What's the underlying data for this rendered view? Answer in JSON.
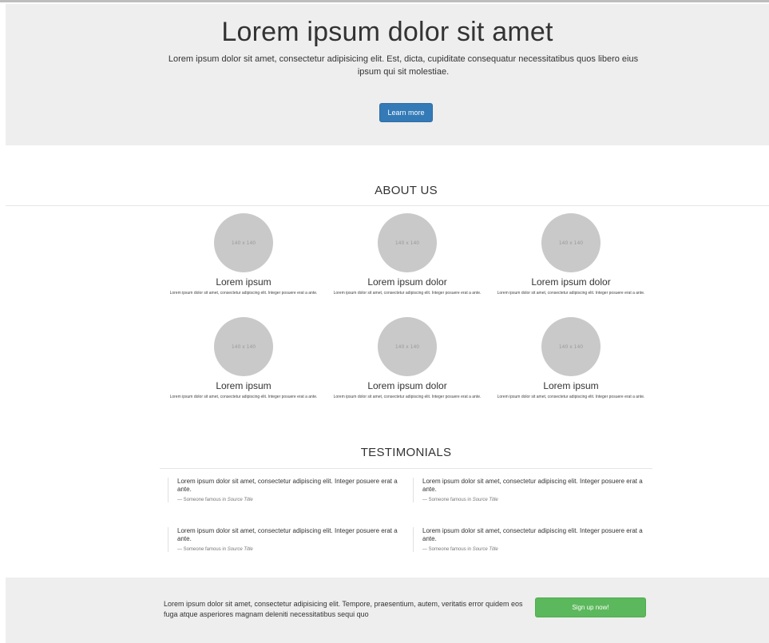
{
  "hero": {
    "title": "Lorem ipsum dolor sit amet",
    "lead": "Lorem ipsum dolor sit amet, consectetur adipisicing elit. Est, dicta, cupiditate consequatur necessitatibus quos libero eius ipsum qui sit molestiae.",
    "button_label": "Learn more",
    "button_color": "#337ab7"
  },
  "about": {
    "heading": "ABOUT US",
    "members": [
      {
        "image_label": "140 x 140",
        "name": "Lorem ipsum",
        "text": "Lorem ipsum dolor sit amet, consectetur adipiscing elit. Integer posuere erat a ante."
      },
      {
        "image_label": "140 x 140",
        "name": "Lorem ipsum dolor",
        "text": "Lorem ipsum dolor sit amet, consectetur adipiscing elit. Integer posuere erat a ante."
      },
      {
        "image_label": "140 x 140",
        "name": "Lorem ipsum dolor",
        "text": "Lorem ipsum dolor sit amet, consectetur adipiscing elit. Integer posuere erat a ante."
      },
      {
        "image_label": "140 x 140",
        "name": "Lorem ipsum",
        "text": "Lorem ipsum dolor sit amet, consectetur adipiscing elit. Integer posuere erat a ante."
      },
      {
        "image_label": "140 x 140",
        "name": "Lorem ipsum dolor",
        "text": "Lorem ipsum dolor sit amet, consectetur adipiscing elit. Integer posuere erat a ante."
      },
      {
        "image_label": "140 x 140",
        "name": "Lorem ipsum",
        "text": "Lorem ipsum dolor sit amet, consectetur adipiscing elit. Integer posuere erat a ante."
      }
    ]
  },
  "testimonials": {
    "heading": "TESTIMONIALS",
    "items": [
      {
        "quote": "Lorem ipsum dolor sit amet, consectetur adipiscing elit. Integer posuere erat a ante.",
        "author": "— Someone famous in ",
        "source": "Source Title"
      },
      {
        "quote": "Lorem ipsum dolor sit amet, consectetur adipiscing elit. Integer posuere erat a ante.",
        "author": "— Someone famous in ",
        "source": "Source Title"
      },
      {
        "quote": "Lorem ipsum dolor sit amet, consectetur adipiscing elit. Integer posuere erat a ante.",
        "author": "— Someone famous in ",
        "source": "Source Title"
      },
      {
        "quote": "Lorem ipsum dolor sit amet, consectetur adipiscing elit. Integer posuere erat a ante.",
        "author": "— Someone famous in ",
        "source": "Source Title"
      }
    ]
  },
  "cta": {
    "text": "Lorem ipsum dolor sit amet, consectetur adipisicing elit. Tempore, praesentium, autem, veritatis error quidem eos fuga atque asperiores magnam deleniti necessitatibus sequi quo",
    "button_label": "Sign up now!",
    "button_color": "#5cb85c"
  }
}
